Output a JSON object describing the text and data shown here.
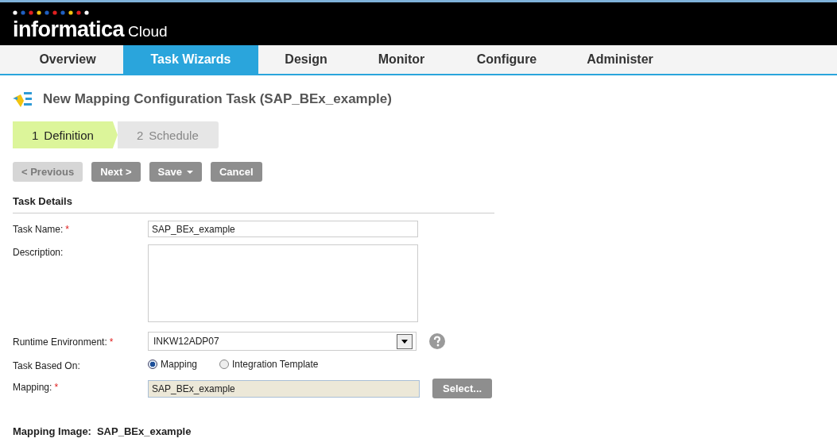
{
  "logo": {
    "name": "informatica",
    "product": "Cloud"
  },
  "nav": [
    {
      "label": "Overview",
      "selected": false
    },
    {
      "label": "Task Wizards",
      "selected": true
    },
    {
      "label": "Design",
      "selected": false
    },
    {
      "label": "Monitor",
      "selected": false
    },
    {
      "label": "Configure",
      "selected": false
    },
    {
      "label": "Administer",
      "selected": false
    }
  ],
  "page_title": "New Mapping Configuration Task (SAP_BEx_example)",
  "steps": [
    {
      "number": "1",
      "label": "Definition",
      "selected": true
    },
    {
      "number": "2",
      "label": "Schedule",
      "selected": false
    }
  ],
  "actions": [
    {
      "label": "< Previous",
      "disabled": true,
      "dropdown": false
    },
    {
      "label": "Next >",
      "disabled": false,
      "dropdown": false
    },
    {
      "label": "Save",
      "disabled": false,
      "dropdown": true
    },
    {
      "label": "Cancel",
      "disabled": false,
      "dropdown": false
    }
  ],
  "section_title": "Task Details",
  "fields": [
    {
      "kind": "text",
      "label": "Task Name:",
      "required_mark": "*",
      "value": "SAP_BEx_example"
    },
    {
      "kind": "textarea",
      "label": "Description:"
    },
    {
      "kind": "select",
      "label": "Runtime Environment:",
      "required_mark": "*",
      "value": "INKW12ADP07",
      "help": true
    },
    {
      "kind": "radio",
      "label": "Task Based On:",
      "options": [
        {
          "label": "Mapping",
          "selected": true
        },
        {
          "label": "Integration Template",
          "selected": false
        }
      ]
    },
    {
      "kind": "readonly",
      "label": "Mapping:",
      "required_mark": "*",
      "value": "SAP_BEx_example",
      "button": "Select..."
    }
  ],
  "mapping_image": {
    "label": "Mapping Image:",
    "value": "SAP_BEx_example"
  }
}
